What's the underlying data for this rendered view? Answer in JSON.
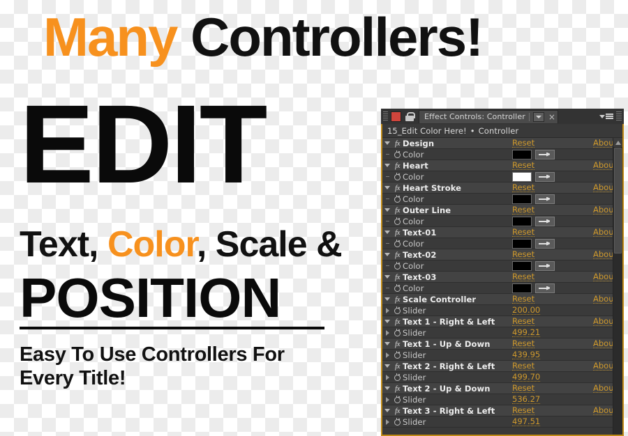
{
  "promo": {
    "headline_prefix": "Many",
    "headline_suffix": " Controllers!",
    "edit_word": "EDIT",
    "features_part1": "Text, ",
    "features_highlight": "Color",
    "features_part2": ", Scale &",
    "position_word": "POSITION",
    "subline": "Easy To Use Controllers For Every Title!",
    "accent_color": "#F7911E",
    "text_color": "#111111"
  },
  "effect_controls": {
    "tab_label": "Effect Controls: Controller",
    "tab_close_glyph": "×",
    "tab_chip_color": "#D0453C",
    "breadcrumb_comp": "15_Edit Color Here!",
    "breadcrumb_separator": "•",
    "breadcrumb_layer": "Controller",
    "accent_border_color": "#C08A16",
    "link_color": "#D09A2C",
    "reset_label": "Reset",
    "about_label": "About...",
    "fx_glyph": "fx",
    "rows": [
      {
        "kind": "effect",
        "name": "Design",
        "reset": "Reset",
        "about": "About..."
      },
      {
        "kind": "color",
        "name": "Color",
        "swatch": "#000000"
      },
      {
        "kind": "effect",
        "name": "Heart",
        "reset": "Reset",
        "about": "About..."
      },
      {
        "kind": "color",
        "name": "Color",
        "swatch": "#FFFFFF"
      },
      {
        "kind": "effect",
        "name": "Heart Stroke",
        "reset": "Reset",
        "about": "About..."
      },
      {
        "kind": "color",
        "name": "Color",
        "swatch": "#000000"
      },
      {
        "kind": "effect",
        "name": "Outer Line",
        "reset": "Reset",
        "about": "About..."
      },
      {
        "kind": "color",
        "name": "Color",
        "swatch": "#000000"
      },
      {
        "kind": "effect",
        "name": "Text-01",
        "reset": "Reset",
        "about": "About..."
      },
      {
        "kind": "color",
        "name": "Color",
        "swatch": "#000000"
      },
      {
        "kind": "effect",
        "name": "Text-02",
        "reset": "Reset",
        "about": "About..."
      },
      {
        "kind": "color",
        "name": "Color",
        "swatch": "#000000"
      },
      {
        "kind": "effect",
        "name": "Text-03",
        "reset": "Reset",
        "about": "About..."
      },
      {
        "kind": "color",
        "name": "Color",
        "swatch": "#000000"
      },
      {
        "kind": "effect",
        "name": "Scale Controller",
        "reset": "Reset",
        "about": "About..."
      },
      {
        "kind": "slider",
        "name": "Slider",
        "value": "200.00"
      },
      {
        "kind": "effect",
        "name": "Text 1 - Right & Left",
        "reset": "Reset",
        "about": "About..."
      },
      {
        "kind": "slider",
        "name": "Slider",
        "value": "499.21"
      },
      {
        "kind": "effect",
        "name": "Text 1 - Up & Down",
        "reset": "Reset",
        "about": "About..."
      },
      {
        "kind": "slider",
        "name": "Slider",
        "value": "439.95"
      },
      {
        "kind": "effect",
        "name": "Text 2 - Right & Left",
        "reset": "Reset",
        "about": "About..."
      },
      {
        "kind": "slider",
        "name": "Slider",
        "value": "499.70"
      },
      {
        "kind": "effect",
        "name": "Text 2 - Up & Down",
        "reset": "Reset",
        "about": "About..."
      },
      {
        "kind": "slider",
        "name": "Slider",
        "value": "536.27"
      },
      {
        "kind": "effect",
        "name": "Text 3 - Right & Left",
        "reset": "Reset",
        "about": "About..."
      },
      {
        "kind": "slider",
        "name": "Slider",
        "value": "497.51"
      }
    ]
  }
}
